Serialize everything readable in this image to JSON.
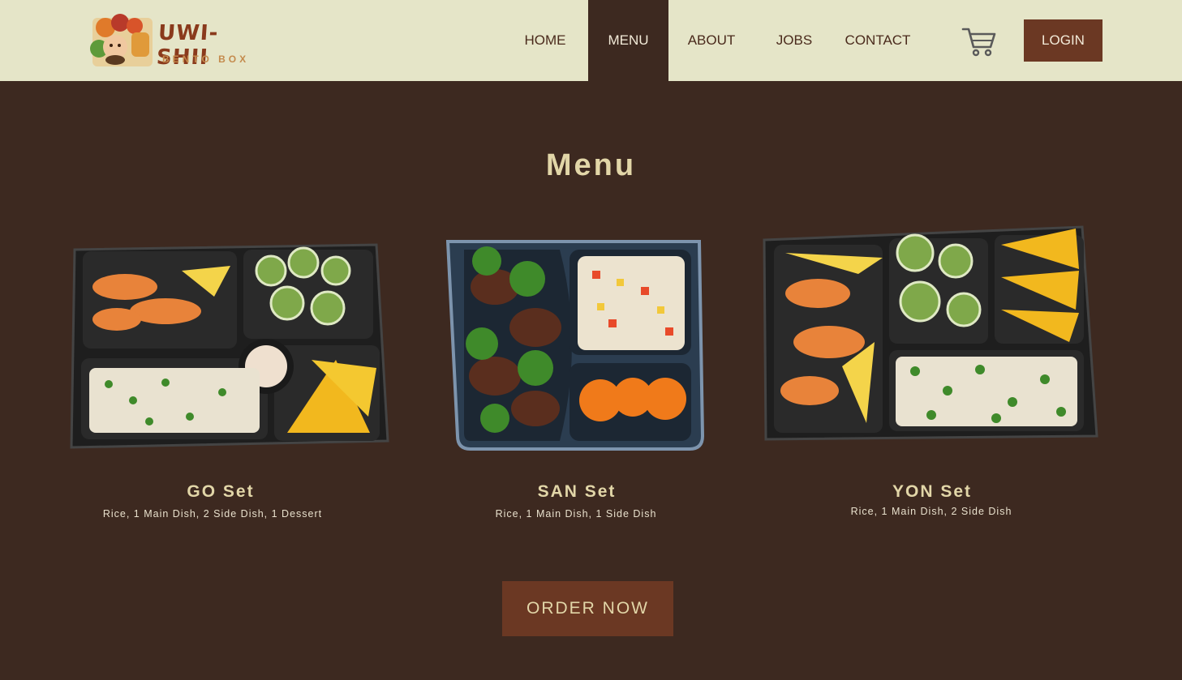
{
  "brand": {
    "name": "UWI-SHII",
    "tagline": "BENTO BOX"
  },
  "nav": {
    "items": [
      {
        "label": "HOME",
        "active": false
      },
      {
        "label": "MENU",
        "active": true
      },
      {
        "label": "ABOUT",
        "active": false
      },
      {
        "label": "JOBS",
        "active": false
      },
      {
        "label": "CONTACT",
        "active": false
      }
    ],
    "cart_icon": "shopping-cart-icon",
    "login_label": "LOGIN"
  },
  "menu": {
    "title": "Menu",
    "sets": [
      {
        "name": "GO Set",
        "description": "Rice, 1 Main Dish, 2 Side Dish, 1 Dessert"
      },
      {
        "name": "SAN Set",
        "description": "Rice, 1 Main Dish, 1 Side Dish"
      },
      {
        "name": "YON Set",
        "description": "Rice, 1 Main Dish, 2 Side Dish"
      }
    ]
  },
  "order_label": "ORDER NOW",
  "colors": {
    "header_bg": "#e5e5c8",
    "page_bg": "#3d2920",
    "accent": "#6b3823",
    "heading": "#e2d6a8"
  }
}
